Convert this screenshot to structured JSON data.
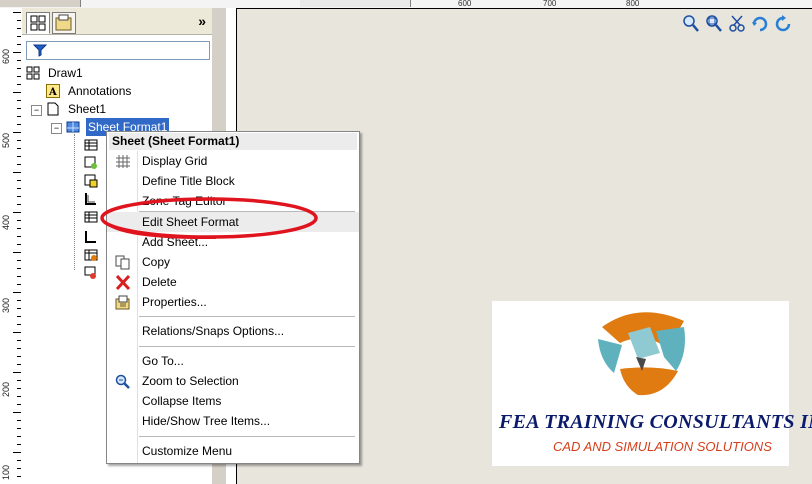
{
  "top_ruler": {
    "ticks": [
      "600",
      "700",
      "800"
    ]
  },
  "left_ruler": {
    "labels": [
      "600",
      "500",
      "400",
      "300",
      "200",
      "100"
    ]
  },
  "panel": {
    "expand_label": "»",
    "tree": {
      "root": "Draw1",
      "annotations": "Annotations",
      "sheet": "Sheet1",
      "sheet_format": "Sheet Format1"
    }
  },
  "context_menu": {
    "title": "Sheet (Sheet Format1)",
    "items": [
      {
        "label": "Display Grid",
        "icon": "grid-icon"
      },
      {
        "label": "Define Title Block",
        "icon": ""
      },
      {
        "label": "Zone Tag Editor",
        "icon": ""
      },
      {
        "label": "Edit Sheet Format",
        "icon": ""
      },
      {
        "label": "Add Sheet...",
        "icon": ""
      },
      {
        "label": "Copy",
        "icon": "copy-icon"
      },
      {
        "label": "Delete",
        "icon": "delete-icon"
      },
      {
        "label": "Properties...",
        "icon": "properties-icon"
      },
      {
        "label": "Relations/Snaps Options...",
        "icon": ""
      },
      {
        "label": "Go To...",
        "icon": ""
      },
      {
        "label": "Zoom to Selection",
        "icon": "zoom-selection-icon"
      },
      {
        "label": "Collapse Items",
        "icon": ""
      },
      {
        "label": "Hide/Show Tree Items...",
        "icon": ""
      },
      {
        "label": "Customize Menu",
        "icon": ""
      }
    ],
    "highlighted": "Edit Sheet Format",
    "annotation_color": "#e0141e"
  },
  "logo": {
    "line1": "FEA TRAINING  CONSULTANTS INC.",
    "line2": "CAD AND SIMULATION SOLUTIONS",
    "colors": {
      "orange": "#e07b12",
      "teal": "#5fb1bd",
      "navy": "#0b1a6b",
      "red": "#d43f1a"
    }
  },
  "hud_icons": [
    "zoom-to-fit-icon",
    "zoom-to-area-icon",
    "scissors-icon",
    "rotate-icon",
    "refresh-icon"
  ],
  "colors": {
    "selection": "#3169c6",
    "canvas": "#e7e5dc"
  }
}
